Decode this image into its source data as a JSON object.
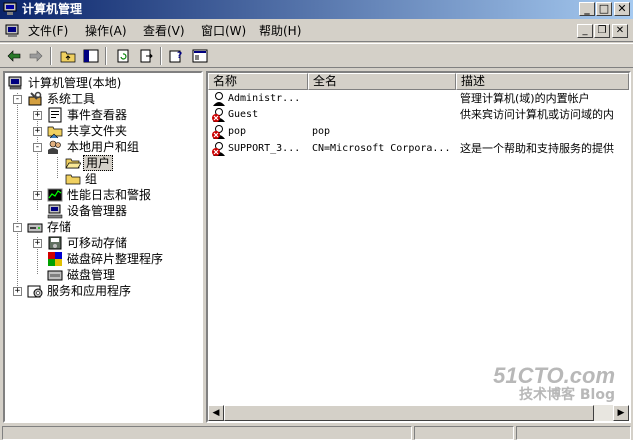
{
  "window": {
    "title": "计算机管理",
    "controls": {
      "minimize": "_",
      "maximize": "□",
      "close": "✕"
    }
  },
  "menu": {
    "items": [
      {
        "label": "文件(F)"
      },
      {
        "label": "操作(A)"
      },
      {
        "label": "查看(V)"
      },
      {
        "label": "窗口(W)"
      },
      {
        "label": "帮助(H)"
      }
    ],
    "child_controls": {
      "minimize": "_",
      "restore": "❐",
      "close": "✕"
    }
  },
  "toolbar": {
    "icons": [
      "back-icon",
      "forward-icon",
      "up-folder-icon",
      "show-tree-icon",
      "refresh-icon",
      "export-list-icon",
      "help-icon",
      "properties-icon"
    ]
  },
  "tree": {
    "items": [
      {
        "label": "计算机管理(本地)",
        "icon": "computer-icon"
      },
      {
        "label": "系统工具",
        "icon": "tools-icon",
        "expander": "-"
      },
      {
        "label": "事件查看器",
        "icon": "event-viewer-icon",
        "expander": "+"
      },
      {
        "label": "共享文件夹",
        "icon": "shared-folder-icon",
        "expander": "+"
      },
      {
        "label": "本地用户和组",
        "icon": "users-groups-icon",
        "expander": "-"
      },
      {
        "label": "用户",
        "icon": "folder-open-icon",
        "selected": true
      },
      {
        "label": "组",
        "icon": "folder-icon"
      },
      {
        "label": "性能日志和警报",
        "icon": "performance-icon",
        "expander": "+"
      },
      {
        "label": "设备管理器",
        "icon": "device-manager-icon"
      },
      {
        "label": "存储",
        "icon": "storage-icon",
        "expander": "-"
      },
      {
        "label": "可移动存储",
        "icon": "removable-storage-icon",
        "expander": "+"
      },
      {
        "label": "磁盘碎片整理程序",
        "icon": "defrag-icon"
      },
      {
        "label": "磁盘管理",
        "icon": "disk-management-icon"
      },
      {
        "label": "服务和应用程序",
        "icon": "services-icon",
        "expander": "+"
      }
    ]
  },
  "list": {
    "columns": [
      "名称",
      "全名",
      "描述"
    ],
    "rows": [
      {
        "name": "Administr...",
        "fullname": "",
        "description": "管理计算机(域)的内置帐户",
        "disabled": false
      },
      {
        "name": "Guest",
        "fullname": "",
        "description": "供来宾访问计算机或访问域的内",
        "disabled": true
      },
      {
        "name": "pop",
        "fullname": "pop",
        "description": "",
        "disabled": true
      },
      {
        "name": "SUPPORT_3...",
        "fullname": "CN=Microsoft Corpora...",
        "description": "这是一个帮助和支持服务的提供",
        "disabled": true
      }
    ]
  },
  "watermark": {
    "line1": "51CTO.com",
    "line2": "技术博客 Blog"
  },
  "colors": {
    "title_start": "#0a246a",
    "title_end": "#a6caf0",
    "face": "#d4d0c8",
    "disabled_badge": "#cc0000"
  }
}
